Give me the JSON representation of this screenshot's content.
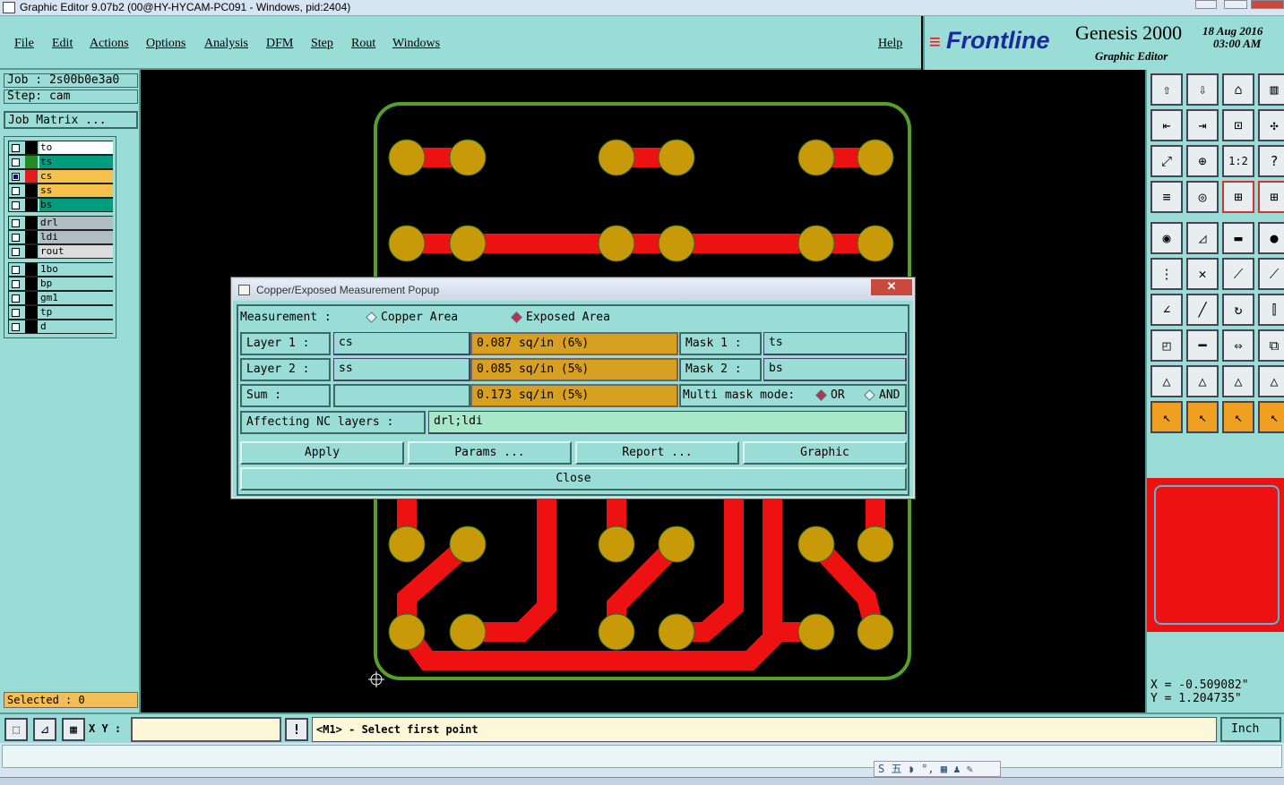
{
  "window": {
    "title": "Graphic Editor 9.07b2 (00@HY-HYCAM-PC091 - Windows, pid:2404)"
  },
  "menu": {
    "items": [
      "File",
      "Edit",
      "Actions",
      "Options",
      "Analysis",
      "DFM",
      "Step",
      "Rout",
      "Windows"
    ],
    "help": "Help"
  },
  "brand": {
    "logo": "Frontline",
    "product": "Genesis 2000",
    "subtitle": "Graphic Editor",
    "date": "18 Aug 2016",
    "time": "03:00 AM"
  },
  "job": {
    "job": "Job : 2s00b0e3a0",
    "step": "Step: cam",
    "matrix_btn": "Job Matrix ..."
  },
  "layers": [
    {
      "name": "to",
      "color": "#ffffff",
      "sw": "#000000"
    },
    {
      "name": "ts",
      "color": "#009e7e",
      "sw": "#228b22"
    },
    {
      "name": "cs",
      "color": "#f7c24b",
      "sw": "#e31c1c",
      "active": true
    },
    {
      "name": "ss",
      "color": "#f7c24b",
      "sw": "#000000"
    },
    {
      "name": "bs",
      "color": "#009e7e",
      "sw": "#000000"
    },
    {
      "name": "drl",
      "color": "#b0bdc4",
      "sw": "#000000"
    },
    {
      "name": "ldi",
      "color": "#b0bdc4",
      "sw": "#000000"
    },
    {
      "name": "rout",
      "color": "#dcdcdc",
      "sw": "#000000"
    },
    {
      "name": "1bo",
      "color": "#9adcd6",
      "sw": "#000000"
    },
    {
      "name": "bp",
      "color": "#9adcd6",
      "sw": "#000000"
    },
    {
      "name": "gm1",
      "color": "#9adcd6",
      "sw": "#000000"
    },
    {
      "name": "tp",
      "color": "#9adcd6",
      "sw": "#000000"
    },
    {
      "name": "d",
      "color": "#9adcd6",
      "sw": "#000000"
    }
  ],
  "selected": "Selected : 0",
  "coords": {
    "x": "X = -0.509082\"",
    "y": "Y = 1.204735\""
  },
  "status": {
    "xy_label": "X Y :",
    "prompt": "<M1> - Select first point",
    "units": "Inch"
  },
  "popup": {
    "title": "Copper/Exposed Measurement Popup",
    "measurement_label": "Measurement :",
    "opt_copper": "Copper Area",
    "opt_exposed": "Exposed Area",
    "layer1_label": "Layer 1 :",
    "layer1_value": "cs",
    "layer1_result": "0.087 sq/in (6%)",
    "layer2_label": "Layer 2 :",
    "layer2_value": "ss",
    "layer2_result": "0.085 sq/in (5%)",
    "sum_label": "Sum :",
    "sum_result": "0.173 sq/in (5%)",
    "mask1_label": "Mask 1 :",
    "mask1_value": "ts",
    "mask2_label": "Mask 2 :",
    "mask2_value": "bs",
    "multi_mask_label": "Multi mask mode:",
    "opt_or": "OR",
    "opt_and": "AND",
    "nc_label": "Affecting NC layers :",
    "nc_value": "drl;ldi",
    "apply": "Apply",
    "params": "Params ...",
    "report": "Report ...",
    "graphic": "Graphic",
    "close": "Close"
  },
  "tools": [
    "load-icon",
    "save-icon",
    "home-icon",
    "window-icon",
    "zoom-out-icon",
    "zoom-in-icon",
    "fit-icon",
    "pan-icon",
    "zoom-fit-icon",
    "center-icon",
    "scale-icon",
    "help-icon",
    "measure-icon",
    "ruler-icon",
    "snap-icon",
    "snap2-icon",
    "pad-icon",
    "route-icon",
    "film-icon",
    "dot-icon",
    "node-icon",
    "cross-icon",
    "line-icon",
    "line2-icon",
    "slope-icon",
    "line3-icon",
    "rotate-icon",
    "mirror-icon",
    "square-icon",
    "dash-icon",
    "dim-icon",
    "group-icon",
    "tri-icon",
    "tri2-icon",
    "tri3-icon",
    "tri4-icon",
    "cursor-icon",
    "cursor2-icon",
    "cursor3-icon",
    "cursor4-icon"
  ]
}
